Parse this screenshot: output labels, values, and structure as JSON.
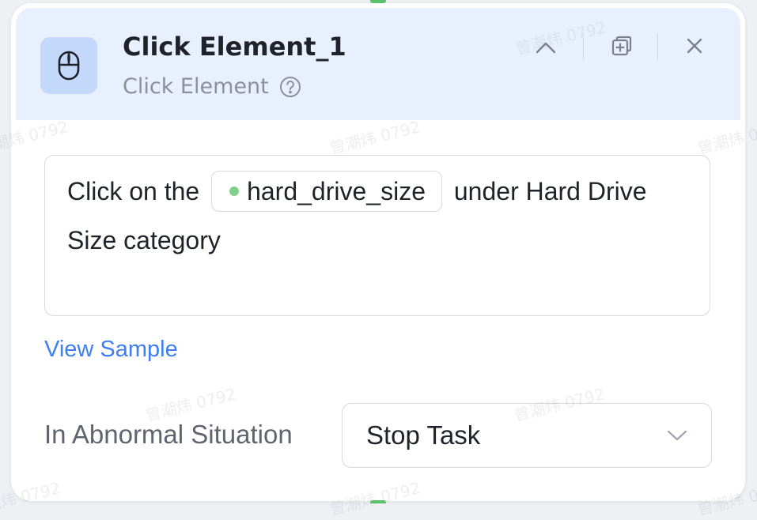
{
  "node": {
    "title": "Click Element_1",
    "subtitle": "Click Element",
    "icon": "mouse-icon",
    "accent_color": "#c4d8fb",
    "header_color": "#e8f0fe"
  },
  "header_actions": {
    "collapse_icon": "chevron-up-icon",
    "copy_icon": "duplicate-icon",
    "close_icon": "close-icon",
    "help_icon": "help-circle-icon"
  },
  "instruction": {
    "text_before": "Click on the",
    "variable": {
      "name": "hard_drive_size",
      "dot_color": "#7ed08a"
    },
    "text_after": "under Hard Drive Size category"
  },
  "view_sample": {
    "label": "View Sample",
    "color": "#3f7ef0"
  },
  "abnormal": {
    "label": "In Abnormal Situation",
    "selected": "Stop Task",
    "chevron_icon": "chevron-down-icon"
  },
  "watermark_text": "曾潮炜 0792"
}
